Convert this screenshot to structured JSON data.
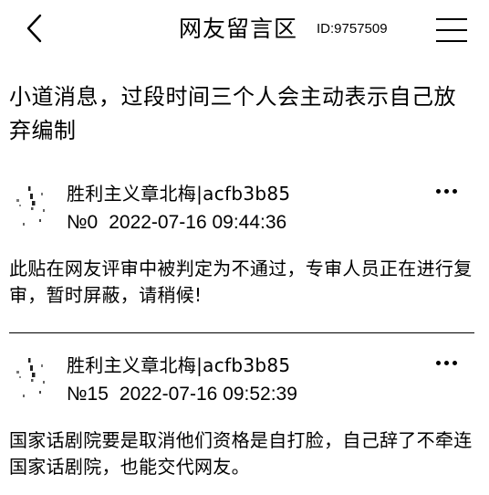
{
  "header": {
    "title": "网友留言区",
    "id_label": "ID:9757509"
  },
  "topic": {
    "text": "小道消息，过段时间三个人会主动表示自己放弃编制"
  },
  "comments": [
    {
      "username": "胜利主义章北梅|acfb3b85",
      "number": "№0",
      "timestamp": "2022-07-16 09:44:36",
      "body": "此贴在网友评审中被判定为不通过，专审人员正在进行复审，暂时屏蔽，请稍候!"
    },
    {
      "username": "胜利主义章北梅|acfb3b85",
      "number": "№15",
      "timestamp": "2022-07-16 09:52:39",
      "body": "国家话剧院要是取消他们资格是自打脸，自己辞了不牵连国家话剧院，也能交代网友。"
    }
  ],
  "icons": {
    "back": "chevron-left-icon",
    "menu": "hamburger-menu-icon",
    "more": "more-horizontal-icon",
    "avatar": "avatar-icon"
  }
}
